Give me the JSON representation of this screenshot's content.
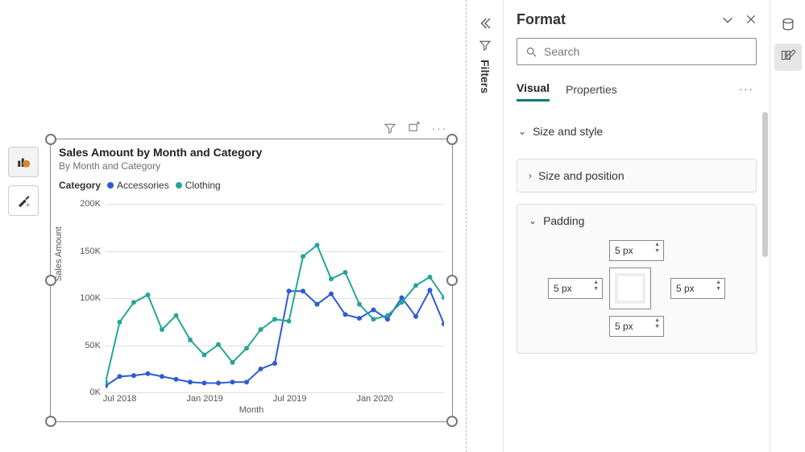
{
  "left_tools": {
    "build_tooltip": "Build visual",
    "format_tooltip": "Format visual"
  },
  "visual_header_icons": [
    "filter-icon",
    "focus-mode-icon",
    "more-options-icon"
  ],
  "chart": {
    "title": "Sales Amount by Month and Category",
    "subtitle": "By Month and Category",
    "legend_title": "Category",
    "xlabel": "Month",
    "ylabel": "Sales Amount"
  },
  "chart_data": {
    "type": "line",
    "xlabel": "Month",
    "ylabel": "Sales Amount",
    "title": "Sales Amount by Month and Category",
    "subtitle": "By Month and Category",
    "ylim": [
      0,
      200000
    ],
    "y_ticks": [
      0,
      50000,
      100000,
      150000,
      200000
    ],
    "y_tick_labels": [
      "0K",
      "50K",
      "100K",
      "150K",
      "200K"
    ],
    "x_tick_labels": [
      "Jul 2018",
      "Jan 2019",
      "Jul 2019",
      "Jan 2020"
    ],
    "legend_title": "Category",
    "legend_position": "top",
    "grid": true,
    "categories": [
      "Jun 2018",
      "Jul 2018",
      "Aug 2018",
      "Sep 2018",
      "Oct 2018",
      "Nov 2018",
      "Dec 2018",
      "Jan 2019",
      "Feb 2019",
      "Mar 2019",
      "Apr 2019",
      "May 2019",
      "Jun 2019",
      "Jul 2019",
      "Aug 2019",
      "Sep 2019",
      "Oct 2019",
      "Nov 2019",
      "Dec 2019",
      "Jan 2020",
      "Feb 2020",
      "Mar 2020",
      "Apr 2020",
      "May 2020",
      "Jun 2020"
    ],
    "series": [
      {
        "name": "Accessories",
        "color": "#2F5BD0",
        "values": [
          6000,
          16000,
          17000,
          19000,
          16000,
          13000,
          10000,
          9000,
          9000,
          10000,
          10000,
          24000,
          30000,
          107000,
          107000,
          93000,
          104000,
          82000,
          78000,
          87000,
          77000,
          100000,
          80000,
          108000,
          72000
        ]
      },
      {
        "name": "Clothing",
        "color": "#25A599",
        "values": [
          10000,
          74000,
          95000,
          103000,
          66000,
          81000,
          55000,
          39000,
          50000,
          31000,
          46000,
          66000,
          77000,
          75000,
          144000,
          156000,
          120000,
          127000,
          93000,
          77000,
          81000,
          95000,
          113000,
          122000,
          100000
        ]
      }
    ]
  },
  "filters_label": "Filters",
  "format_pane": {
    "title": "Format",
    "search_placeholder": "Search",
    "tab_visual": "Visual",
    "tab_properties": "Properties",
    "section_size_style": "Size and style",
    "section_size_position": "Size and position",
    "section_padding": "Padding",
    "padding_values": {
      "top": "5 px",
      "right": "5 px",
      "bottom": "5 px",
      "left": "5 px"
    }
  }
}
